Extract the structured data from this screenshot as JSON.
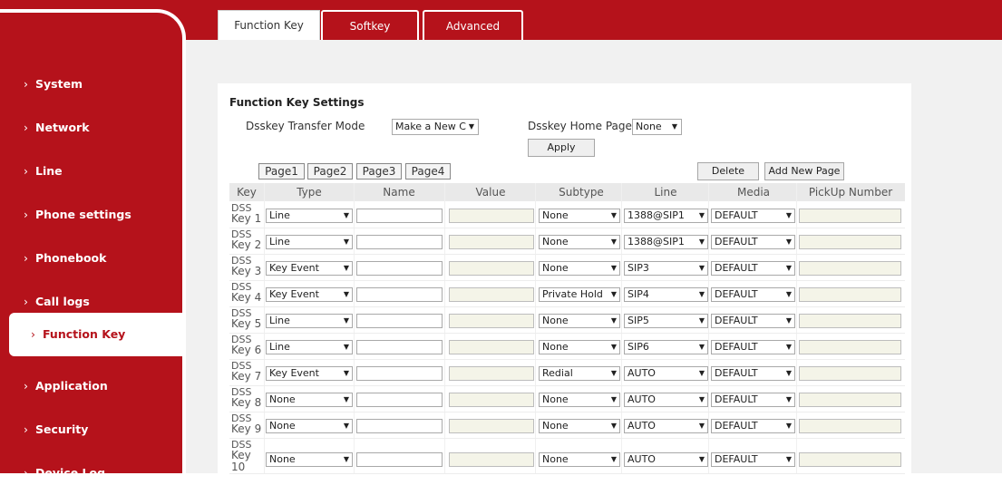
{
  "tabs": [
    {
      "label": "Function Key",
      "active": true
    },
    {
      "label": "Softkey",
      "active": false
    },
    {
      "label": "Advanced",
      "active": false
    }
  ],
  "sidebar": {
    "items": [
      {
        "label": "System"
      },
      {
        "label": "Network"
      },
      {
        "label": "Line"
      },
      {
        "label": "Phone settings"
      },
      {
        "label": "Phonebook"
      },
      {
        "label": "Call logs"
      },
      {
        "label": "Function Key",
        "active": true
      },
      {
        "label": "Application"
      },
      {
        "label": "Security"
      },
      {
        "label": "Device Log"
      }
    ]
  },
  "settings": {
    "title": "Function Key Settings",
    "transfer_mode_label": "Dsskey Transfer Mode",
    "transfer_mode_value": "Make a New C",
    "home_page_label": "Dsskey Home Page:",
    "home_page_value": "None",
    "apply_label": "Apply"
  },
  "pages": {
    "buttons": [
      "Page1",
      "Page2",
      "Page3",
      "Page4"
    ],
    "delete_label": "Delete",
    "add_label": "Add New Page"
  },
  "table": {
    "headers": [
      "Key",
      "Type",
      "Name",
      "Value",
      "Subtype",
      "Line",
      "Media",
      "PickUp Number"
    ],
    "rows": [
      {
        "key_top": "DSS",
        "key_bottom": "Key 1",
        "type": "Line",
        "subtype": "None",
        "line": "1388@SIP1",
        "media": "DEFAULT"
      },
      {
        "key_top": "DSS",
        "key_bottom": "Key 2",
        "type": "Line",
        "subtype": "None",
        "line": "1388@SIP1",
        "media": "DEFAULT"
      },
      {
        "key_top": "DSS",
        "key_bottom": "Key 3",
        "type": "Key Event",
        "subtype": "None",
        "line": "SIP3",
        "media": "DEFAULT"
      },
      {
        "key_top": "DSS",
        "key_bottom": "Key 4",
        "type": "Key Event",
        "subtype": "Private Hold",
        "line": "SIP4",
        "media": "DEFAULT"
      },
      {
        "key_top": "DSS",
        "key_bottom": "Key 5",
        "type": "Line",
        "subtype": "None",
        "line": "SIP5",
        "media": "DEFAULT"
      },
      {
        "key_top": "DSS",
        "key_bottom": "Key 6",
        "type": "Line",
        "subtype": "None",
        "line": "SIP6",
        "media": "DEFAULT"
      },
      {
        "key_top": "DSS",
        "key_bottom": "Key 7",
        "type": "Key Event",
        "subtype": "Redial",
        "line": "AUTO",
        "media": "DEFAULT"
      },
      {
        "key_top": "DSS",
        "key_bottom": "Key 8",
        "type": "None",
        "subtype": "None",
        "line": "AUTO",
        "media": "DEFAULT"
      },
      {
        "key_top": "DSS",
        "key_bottom": "Key 9",
        "type": "None",
        "subtype": "None",
        "line": "AUTO",
        "media": "DEFAULT"
      },
      {
        "key_top": "DSS",
        "key_bottom": "Key 10",
        "type": "None",
        "subtype": "None",
        "line": "AUTO",
        "media": "DEFAULT"
      }
    ]
  },
  "colors": {
    "brand": "#b5121b",
    "background": "#f1f1f1"
  }
}
